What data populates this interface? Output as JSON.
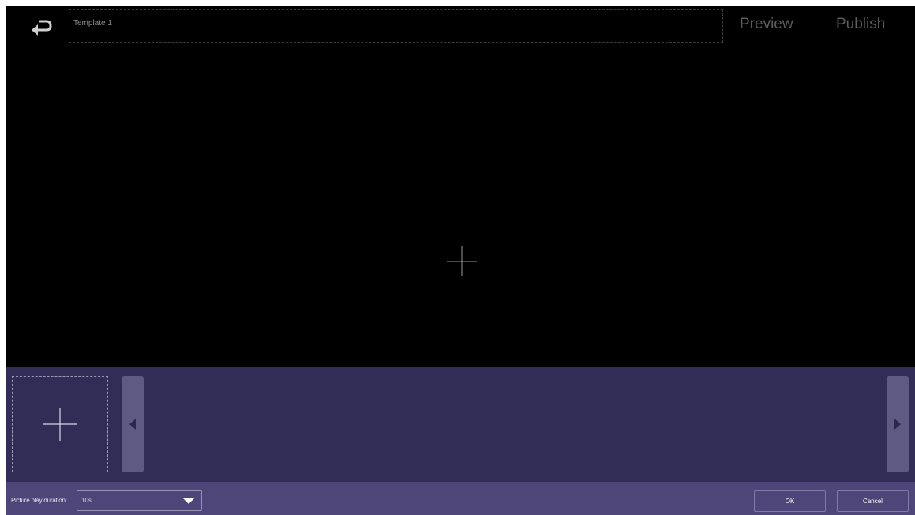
{
  "header": {
    "back_icon": "return-arrow-icon",
    "title_value": "Template 1",
    "preview_label": "Preview",
    "publish_label": "Publish"
  },
  "canvas": {
    "add_icon": "plus-icon"
  },
  "strip": {
    "add_icon": "plus-icon",
    "left_icon": "triangle-left-icon",
    "right_icon": "triangle-right-icon"
  },
  "footer": {
    "duration_label": "Picture play duration:",
    "duration_value": "10s",
    "ok_label": "OK",
    "cancel_label": "Cancel"
  },
  "colors": {
    "stage_background": "#000000",
    "strip_background": "#312d57",
    "bottom_bar_background": "#4e4678",
    "nav_button": "#5f5a83"
  }
}
